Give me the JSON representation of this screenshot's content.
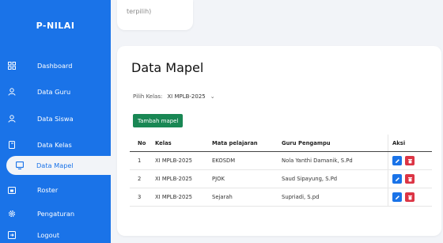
{
  "sidebar": {
    "brand": "P-NILAI",
    "items": [
      {
        "label": "Dashboard",
        "icon": "dashboard-grid-icon"
      },
      {
        "label": "Data Guru",
        "icon": "user-icon"
      },
      {
        "label": "Data Siswa",
        "icon": "user-icon"
      },
      {
        "label": "Data Kelas",
        "icon": "book-icon"
      },
      {
        "label": "Data Mapel",
        "icon": "monitor-icon",
        "active": true
      },
      {
        "label": "Roster",
        "icon": "calendar-icon"
      },
      {
        "label": "Pengaturan",
        "icon": "gear-icon"
      },
      {
        "label": "Logout",
        "icon": "logout-icon"
      }
    ]
  },
  "top_card": {
    "text": "terpilih)"
  },
  "main": {
    "title": "Data Mapel",
    "pilih_label": "Pilih Kelas:",
    "selected_class": "XI MPLB-2025",
    "add_button": "Tambah mapel",
    "table": {
      "headers": [
        "No",
        "Kelas",
        "Mata pelajaran",
        "Guru Pengampu",
        "Aksi"
      ],
      "rows": [
        [
          "1",
          "XI MPLB-2025",
          "EKOSDM",
          "Nola Yanthi Damanik, S.Pd"
        ],
        [
          "2",
          "XI MPLB-2025",
          "PJOK",
          "Saud Sipayung, S.Pd"
        ],
        [
          "3",
          "XI MPLB-2025",
          "Sejarah",
          "Supriadi, S.pd"
        ]
      ]
    }
  },
  "colors": {
    "sidebar": "#1a73e8",
    "add_button": "#198754",
    "edit": "#1a73e8",
    "delete": "#dc3545"
  }
}
